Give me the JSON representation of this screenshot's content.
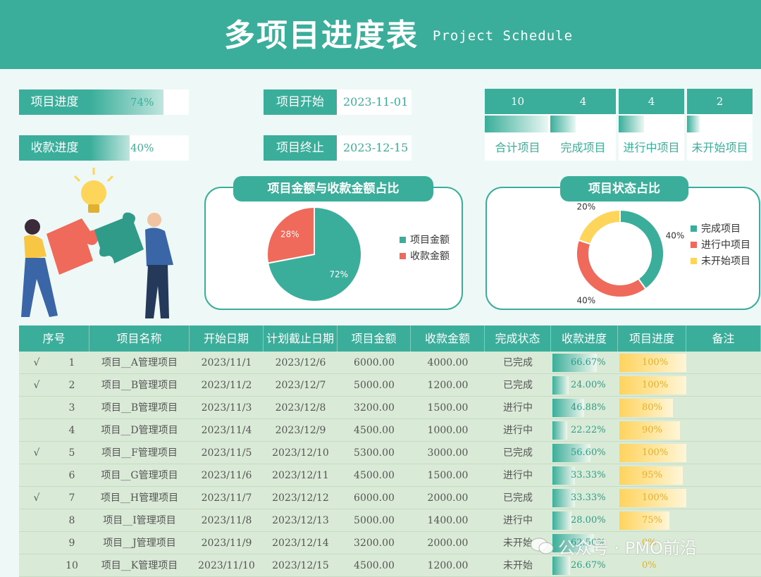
{
  "header": {
    "title": "多项目进度表",
    "subtitle": "Project  Schedule"
  },
  "summary": {
    "project_progress_label": "项目进度",
    "project_progress_value": "74%",
    "project_progress_frac": 0.74,
    "payment_progress_label": "收款进度",
    "payment_progress_value": "40%",
    "payment_progress_frac": 0.4,
    "start_label": "项目开始",
    "start_value": "2023-11-01",
    "end_label": "项目终止",
    "end_value": "2023-12-15"
  },
  "stats": [
    {
      "count": "10",
      "label": "合计项目",
      "frac": 1.0
    },
    {
      "count": "4",
      "label": "完成项目",
      "frac": 0.4
    },
    {
      "count": "4",
      "label": "进行中项目",
      "frac": 0.4
    },
    {
      "count": "2",
      "label": "未开始项目",
      "frac": 0.2
    }
  ],
  "colors": {
    "teal": "#3aae9a",
    "red": "#ef6a5b",
    "yellow": "#fcd55a"
  },
  "chart_data": [
    {
      "type": "pie",
      "title": "项目金额与收款金额占比",
      "categories": [
        "项目金额",
        "收款金额"
      ],
      "values": [
        72,
        28
      ],
      "labels": [
        "72%",
        "28%"
      ],
      "colors": [
        "#3aae9a",
        "#ef6a5b"
      ],
      "legend": "right"
    },
    {
      "type": "pie",
      "title": "项目状态占比",
      "categories": [
        "完成项目",
        "进行中项目",
        "未开始项目"
      ],
      "values": [
        40,
        40,
        20
      ],
      "labels": [
        "40%",
        "40%",
        "20%"
      ],
      "colors": [
        "#3aae9a",
        "#ef6a5b",
        "#fcd55a"
      ],
      "legend": "right"
    }
  ],
  "table": {
    "columns": [
      "序号",
      "项目名称",
      "开始日期",
      "计划截止日期",
      "项目金额",
      "收款金额",
      "完成状态",
      "收款进度",
      "项目进度",
      "备注"
    ],
    "rows": [
      {
        "check": "√",
        "no": "1",
        "name": "项目__A管理项目",
        "start": "2023/11/1",
        "end": "2023/12/6",
        "amount": "6000.00",
        "paid": "4000.00",
        "status": "已完成",
        "pay": "66.67%",
        "pay_frac": 0.6667,
        "prog": "100%",
        "prog_frac": 1.0,
        "note": ""
      },
      {
        "check": "√",
        "no": "2",
        "name": "项目__B管理项目",
        "start": "2023/11/2",
        "end": "2023/12/7",
        "amount": "5000.00",
        "paid": "1200.00",
        "status": "已完成",
        "pay": "24.00%",
        "pay_frac": 0.24,
        "prog": "100%",
        "prog_frac": 1.0,
        "note": ""
      },
      {
        "check": "",
        "no": "3",
        "name": "项目__B管理项目",
        "start": "2023/11/3",
        "end": "2023/12/8",
        "amount": "3200.00",
        "paid": "1500.00",
        "status": "进行中",
        "pay": "46.88%",
        "pay_frac": 0.4688,
        "prog": "80%",
        "prog_frac": 0.8,
        "note": ""
      },
      {
        "check": "",
        "no": "4",
        "name": "项目__D管理项目",
        "start": "2023/11/4",
        "end": "2023/12/9",
        "amount": "4500.00",
        "paid": "1000.00",
        "status": "进行中",
        "pay": "22.22%",
        "pay_frac": 0.2222,
        "prog": "90%",
        "prog_frac": 0.9,
        "note": ""
      },
      {
        "check": "√",
        "no": "5",
        "name": "项目__F管理项目",
        "start": "2023/11/5",
        "end": "2023/12/10",
        "amount": "5300.00",
        "paid": "3000.00",
        "status": "已完成",
        "pay": "56.60%",
        "pay_frac": 0.566,
        "prog": "100%",
        "prog_frac": 1.0,
        "note": ""
      },
      {
        "check": "",
        "no": "6",
        "name": "项目__G管理项目",
        "start": "2023/11/6",
        "end": "2023/12/11",
        "amount": "4500.00",
        "paid": "1500.00",
        "status": "进行中",
        "pay": "33.33%",
        "pay_frac": 0.3333,
        "prog": "95%",
        "prog_frac": 0.95,
        "note": ""
      },
      {
        "check": "√",
        "no": "7",
        "name": "项目__H管理项目",
        "start": "2023/11/7",
        "end": "2023/12/12",
        "amount": "6000.00",
        "paid": "2000.00",
        "status": "已完成",
        "pay": "33.33%",
        "pay_frac": 0.3333,
        "prog": "100%",
        "prog_frac": 1.0,
        "note": ""
      },
      {
        "check": "",
        "no": "8",
        "name": "项目__I管理项目",
        "start": "2023/11/8",
        "end": "2023/12/13",
        "amount": "5000.00",
        "paid": "1400.00",
        "status": "进行中",
        "pay": "28.00%",
        "pay_frac": 0.28,
        "prog": "75%",
        "prog_frac": 0.75,
        "note": ""
      },
      {
        "check": "",
        "no": "9",
        "name": "项目__J管理项目",
        "start": "2023/11/9",
        "end": "2023/12/14",
        "amount": "3200.00",
        "paid": "2000.00",
        "status": "未开始",
        "pay": "62.50%",
        "pay_frac": 0.625,
        "prog": "0%",
        "prog_frac": 0.0,
        "note": ""
      },
      {
        "check": "",
        "no": "10",
        "name": "项目__K管理项目",
        "start": "2023/11/10",
        "end": "2023/12/15",
        "amount": "4500.00",
        "paid": "1200.00",
        "status": "未开始",
        "pay": "26.67%",
        "pay_frac": 0.2667,
        "prog": "0%",
        "prog_frac": 0.0,
        "note": ""
      }
    ]
  },
  "watermark": "公众号 · PMO前沿"
}
